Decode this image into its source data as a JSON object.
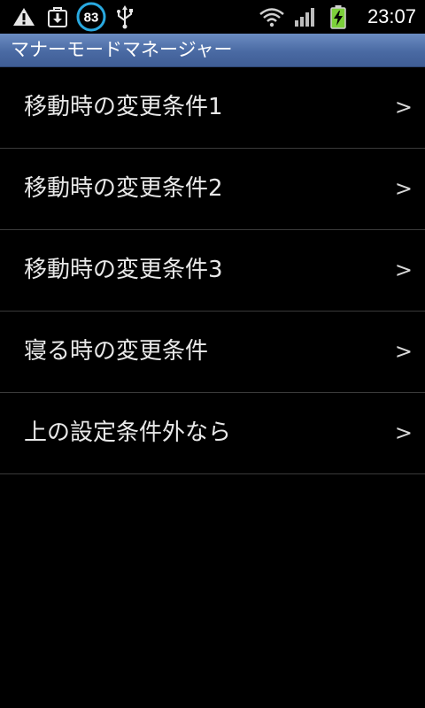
{
  "status_bar": {
    "battery_level_badge": "83",
    "time": "23:07",
    "icons": [
      "warning-icon",
      "download-icon",
      "battery-circle-icon",
      "usb-icon",
      "wifi-icon",
      "signal-icon",
      "battery-charging-icon"
    ],
    "colors": {
      "circle_accent": "#29a9e0",
      "battery_fill": "#7cd03a"
    }
  },
  "title_bar": {
    "title": "マナーモードマネージャー",
    "color": "#4a6aa3"
  },
  "list": {
    "items": [
      {
        "label": "移動時の変更条件1",
        "chevron": ">"
      },
      {
        "label": "移動時の変更条件2",
        "chevron": ">"
      },
      {
        "label": "移動時の変更条件3",
        "chevron": ">"
      },
      {
        "label": "寝る時の変更条件",
        "chevron": ">"
      },
      {
        "label": "上の設定条件外なら",
        "chevron": ">"
      }
    ]
  }
}
